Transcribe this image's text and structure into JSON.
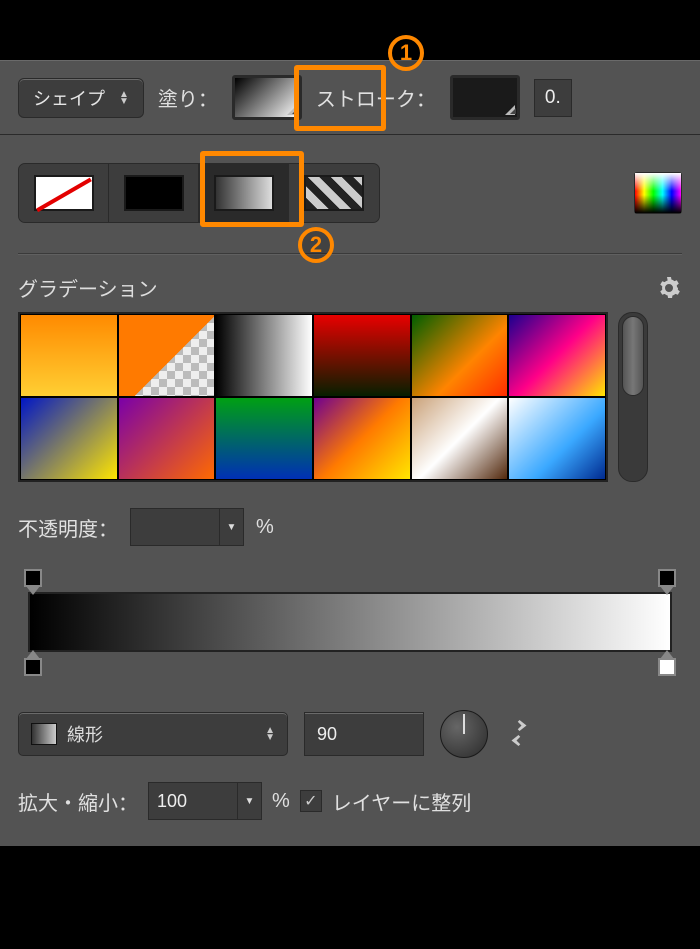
{
  "optbar": {
    "mode_label": "シェイプ",
    "fill_label": "塗り：",
    "stroke_label": "ストローク：",
    "stroke_width": "0."
  },
  "annotations": {
    "n1": "1",
    "n2": "2"
  },
  "gradient": {
    "section_title": "グラデーション",
    "opacity_label": "不透明度：",
    "opacity_value": "",
    "opacity_unit": "%",
    "type_label": "線形",
    "angle": "90",
    "scale_label": "拡大・縮小：",
    "scale_value": "100",
    "scale_unit": "%",
    "align_label": "レイヤーに整列"
  },
  "presets": [
    {
      "bg": "linear-gradient(180deg,#ff8a00 0%,#ffcf33 100%)"
    },
    {
      "bg": "linear-gradient(135deg,#ff7a00 0%,#ff7a00 55%,transparent 55.1%), repeating-conic-gradient(#bbb 0 25%, #eee 0 50%)"
    },
    {
      "bg": "linear-gradient(90deg,#000 0%,#fff 100%)"
    },
    {
      "bg": "linear-gradient(180deg,#e80000 0%,#061f00 100%)"
    },
    {
      "bg": "linear-gradient(135deg,#005e00 0%,#ff8400 60%,#ff2d00 100%)"
    },
    {
      "bg": "linear-gradient(135deg,#1b008f 0%,#ff0088 50%,#ffe600 100%)"
    },
    {
      "bg": "linear-gradient(135deg,#0016c6 0%,#ffe600 100%)"
    },
    {
      "bg": "linear-gradient(135deg,#7a00a8 0%,#ff6a00 100%)"
    },
    {
      "bg": "linear-gradient(180deg,#00a013 0%,#0030b5 100%)"
    },
    {
      "bg": "linear-gradient(135deg,#6f008f 0%,#ff7a00 50%,#ffe600 100%)"
    },
    {
      "bg": "linear-gradient(135deg,#caa27a 0%,#fff 50%,#52280c 100%)"
    },
    {
      "bg": "linear-gradient(135deg,#ffffff 0%,#3aa8ff 60%,#002a8f 100%)"
    }
  ]
}
